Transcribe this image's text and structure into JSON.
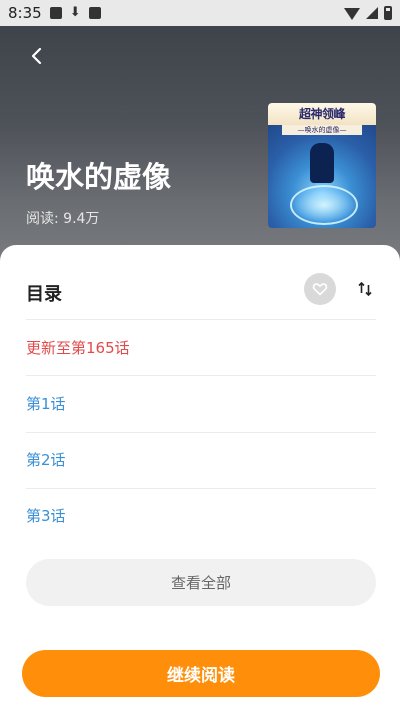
{
  "status_bar": {
    "time": "8:35",
    "left_icons": [
      "image-notification-icon",
      "download-icon",
      "app-notification-icon"
    ],
    "right_icons": [
      "wifi-icon",
      "signal-icon",
      "battery-icon"
    ]
  },
  "book": {
    "title": "唤水的虚像",
    "read_count": "阅读: 9.4万",
    "cover": {
      "title_text": "超神领峰",
      "subtitle_text": "—唤水的虚像—"
    }
  },
  "toc": {
    "title": "目录",
    "latest": "更新至第165话",
    "chapters": [
      "第1话",
      "第2话",
      "第3话"
    ],
    "view_all": "查看全部"
  },
  "footer": {
    "continue_label": "继续阅读"
  },
  "colors": {
    "accent_orange": "#ff8f0a",
    "update_red": "#e24b4b",
    "chapter_blue": "#3a8fd6"
  }
}
